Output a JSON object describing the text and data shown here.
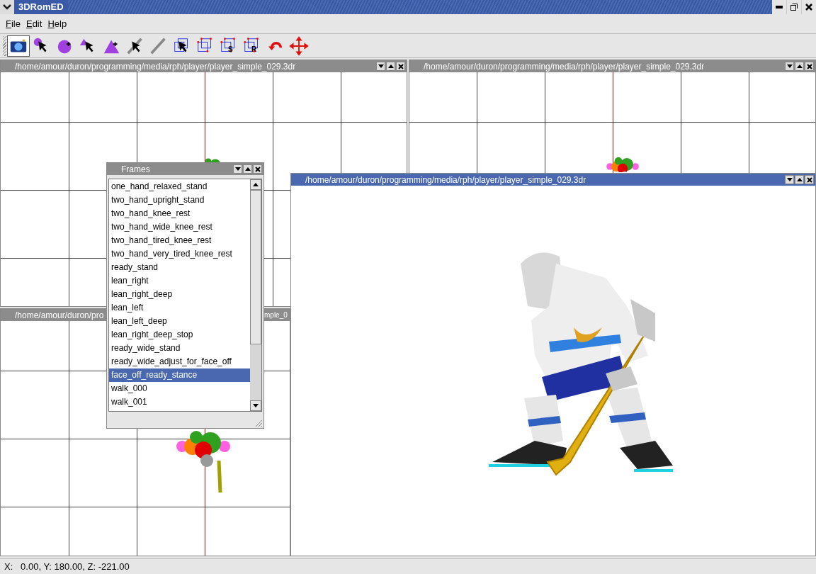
{
  "app": {
    "title": "3DRomED"
  },
  "menu": [
    {
      "label": "File"
    },
    {
      "label": "Edit"
    },
    {
      "label": "Help"
    }
  ],
  "toolbar": [
    {
      "kind": "camera",
      "selected": true
    },
    {
      "kind": "sphere-select",
      "selected": false
    },
    {
      "kind": "sphere-add",
      "selected": false
    },
    {
      "kind": "triangle-select",
      "selected": false
    },
    {
      "kind": "triangle-add",
      "selected": false
    },
    {
      "kind": "line-select",
      "selected": false
    },
    {
      "kind": "line",
      "selected": false
    },
    {
      "kind": "cube-select",
      "selected": false
    },
    {
      "kind": "cube",
      "selected": false
    },
    {
      "kind": "cube-letter",
      "letter": "S",
      "selected": false
    },
    {
      "kind": "cube-letter",
      "letter": "R",
      "selected": false
    },
    {
      "kind": "rotate",
      "selected": false
    },
    {
      "kind": "move",
      "selected": false
    }
  ],
  "viewports": [
    {
      "title": "/home/amour/duron/programming/media/rph/player/player_simple_029.3dr",
      "active": false
    },
    {
      "title": "/home/amour/duron/programming/media/rph/player/player_simple_029.3dr",
      "active": false
    }
  ],
  "partial_viewport": {
    "title_start": "/home/amour/duron/pro",
    "title_end": "mple_0"
  },
  "model_window": {
    "title": "/home/amour/duron/programming/media/rph/player/player_simple_029.3dr",
    "active": true
  },
  "frames": {
    "title": "Frames",
    "items": [
      {
        "label": "one_hand_relaxed_stand",
        "selected": false
      },
      {
        "label": "two_hand_upright_stand",
        "selected": false
      },
      {
        "label": "two_hand_knee_rest",
        "selected": false
      },
      {
        "label": "two_hand_wide_knee_rest",
        "selected": false
      },
      {
        "label": "two_hand_tired_knee_rest",
        "selected": false
      },
      {
        "label": "two_hand_very_tired_knee_rest",
        "selected": false
      },
      {
        "label": "ready_stand",
        "selected": false
      },
      {
        "label": "lean_right",
        "selected": false
      },
      {
        "label": "lean_right_deep",
        "selected": false
      },
      {
        "label": "lean_left",
        "selected": false
      },
      {
        "label": "lean_left_deep",
        "selected": false
      },
      {
        "label": "lean_right_deep_stop",
        "selected": false
      },
      {
        "label": "ready_wide_stand",
        "selected": false
      },
      {
        "label": "ready_wide_adjust_for_face_off",
        "selected": false
      },
      {
        "label": "face_off_ready_stance",
        "selected": true
      },
      {
        "label": "walk_000",
        "selected": false
      },
      {
        "label": "walk_001",
        "selected": false
      }
    ]
  },
  "status_bar": {
    "coordinates": "X:   0.00, Y: 180.00, Z: -221.00"
  }
}
